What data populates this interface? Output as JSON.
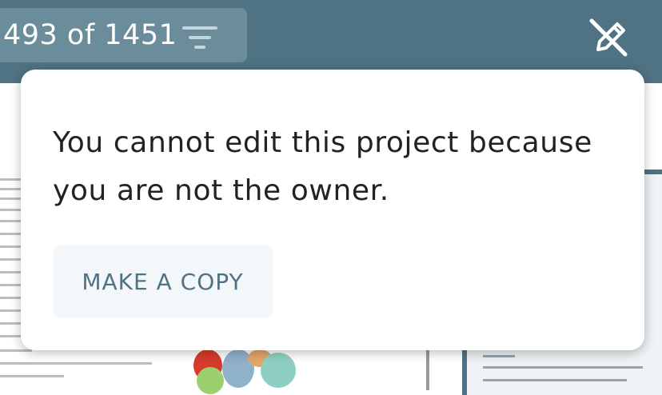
{
  "header": {
    "counter_text": "493 of 1451",
    "filter_icon": "filter-icon",
    "edit_off_icon": "edit-off-icon",
    "bar_color": "#4f7383"
  },
  "popover": {
    "message": "You cannot edit this project because you are not the owner.",
    "copy_button_label": "MAKE A COPY"
  }
}
